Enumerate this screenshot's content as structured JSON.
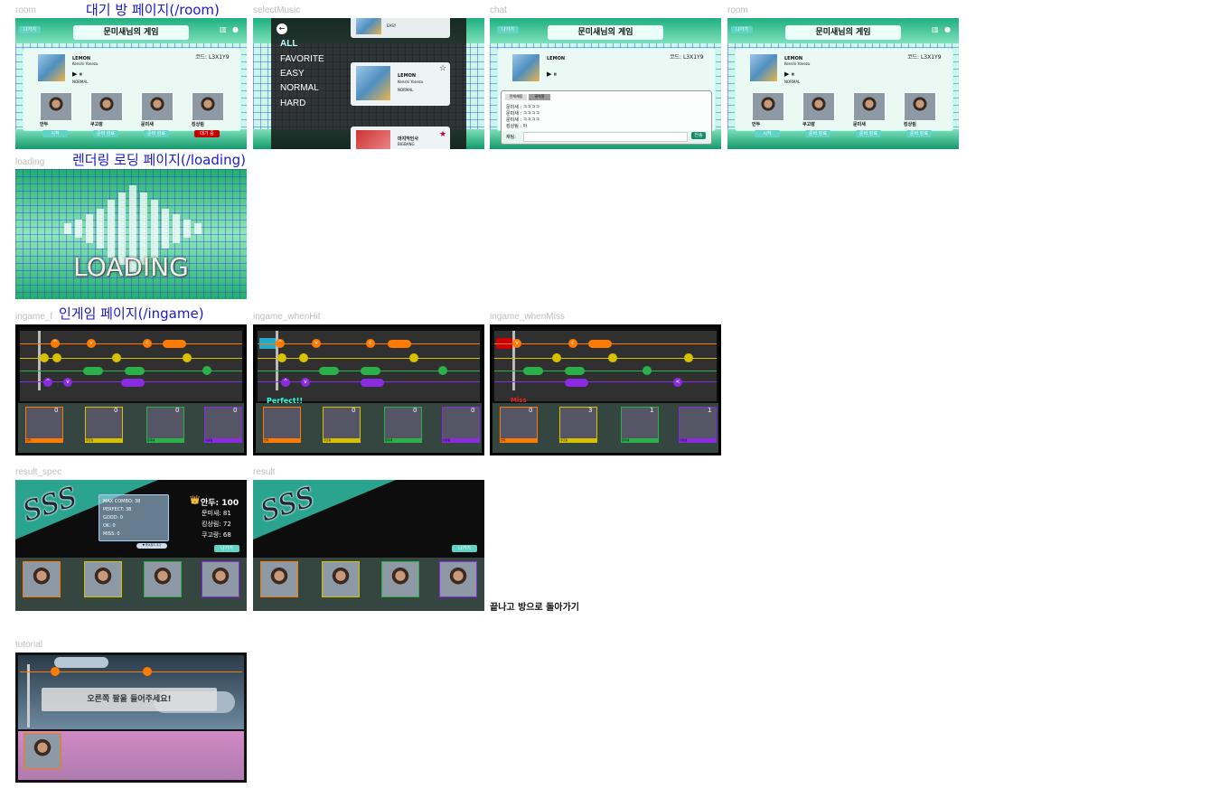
{
  "headings": {
    "room": "대기 방 페이지(/room)",
    "loading": "렌더링 로딩 페이지(/loading)",
    "ingame": "인게임 페이지(/ingame)"
  },
  "frame_labels": {
    "room1": "room",
    "select": "selectMusic",
    "chat": "chat",
    "room2": "room",
    "loading": "loading",
    "ingame": "ingame_f",
    "hit": "ingame_whenHit",
    "miss": "ingame_whenMiss",
    "result_spec": "result_spec",
    "result": "result",
    "tutorial": "tutorial"
  },
  "room": {
    "leave": "나가기",
    "title": "문미새님의 게임",
    "code": "코드: L3X1Y9",
    "song_title": "LEMON",
    "song_artist": "Kenshi Yonezu",
    "song_sub": "3:5",
    "song_diff": "NORMAL",
    "play_icon": "▶ ⏸",
    "players": [
      "안두",
      "쿠고랑",
      "문미새",
      "킹상림"
    ],
    "btn_start": "시작",
    "btn_ready": "준비 완료",
    "btn_waiting": "대기 중"
  },
  "select": {
    "back_icon": "←",
    "menu": [
      "ALL",
      "FAVORITE",
      "EASY",
      "NORMAL",
      "HARD"
    ],
    "song1_title": "LEMON",
    "song1_artist": "Kenshi Yonezu",
    "song1_diff": "NORMAL",
    "song1_star": "☆",
    "song2_title": "마지막인사",
    "song2_artist": "BIGBANG",
    "song2_star": "★",
    "top_diff": "EASY"
  },
  "chat": {
    "tabs": [
      "전체채팅",
      "귓속말"
    ],
    "lines": [
      "문미새 : ㅋㅋㅋㅋ",
      "문미새 : ㅋㅋㅋㅋ",
      "문미새 : ㅋㅋㅋㅋ",
      "킹상림 : 아"
    ],
    "input_label": "채팅:",
    "send": "전송"
  },
  "loading": {
    "text": "LOADING"
  },
  "ingame": {
    "scores": [
      "0",
      "0",
      "0",
      "0"
    ],
    "hit_text": "Perfect!!",
    "miss_text": "Miss",
    "miss_scores": [
      "0",
      "3",
      "1",
      "1"
    ],
    "player_tags": [
      "안두",
      "쿠고랑",
      "문미새",
      "킹상림"
    ]
  },
  "result": {
    "grade": "SSS",
    "stats": [
      "MAX COMBO: 38",
      "PERFECT: 38",
      "GOOD: 0",
      "OK: 0",
      "MISS: 0"
    ],
    "fav_badge": "♥ 즐겨찾기 추가",
    "crown_icon": "👑",
    "ranking": [
      "안두: 100",
      "문미새: 81",
      "킹상림: 72",
      "쿠고랑: 68"
    ],
    "leave": "나가기",
    "back_caption": "끝나고 방으로 돌아가기"
  },
  "tutorial": {
    "instruction": "오른쪽 팔을 들어주세요!"
  },
  "colors": {
    "orange": "#ff7a00",
    "yellow": "#d8c200",
    "green": "#2bb04a",
    "purple": "#8a2be2",
    "teal": "#5fd4c4",
    "red": "#c40000"
  }
}
